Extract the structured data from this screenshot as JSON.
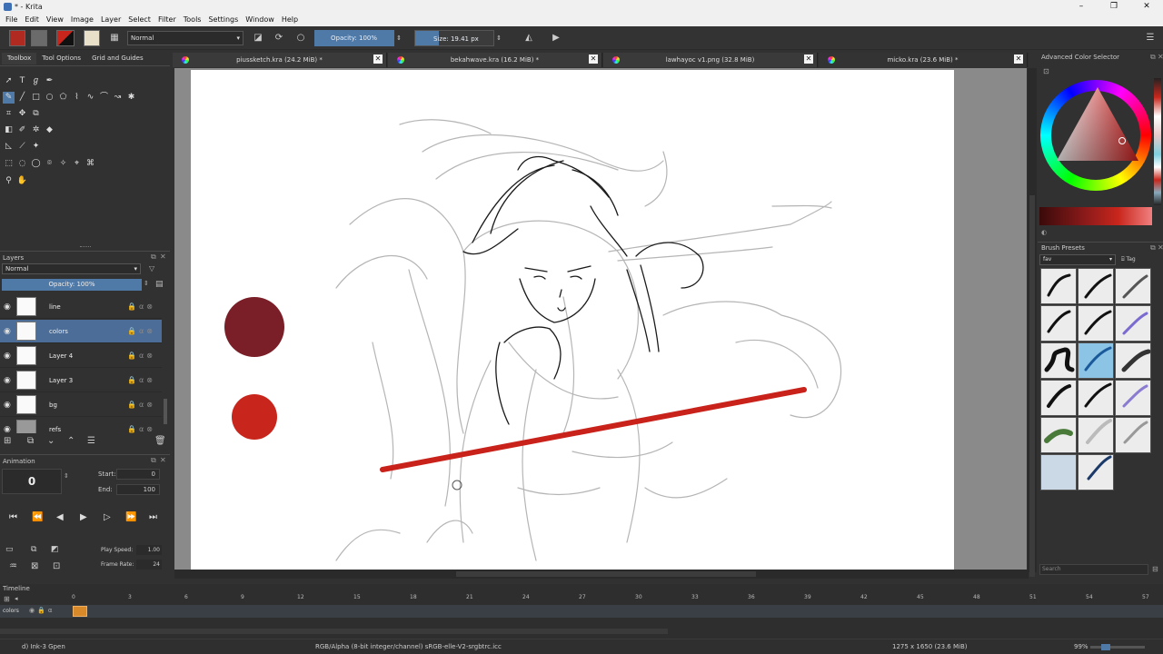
{
  "window": {
    "title": "* - Krita",
    "minimize": "–",
    "maximize": "❐",
    "close": "✕"
  },
  "menu": [
    "File",
    "Edit",
    "View",
    "Image",
    "Layer",
    "Select",
    "Filter",
    "Tools",
    "Settings",
    "Window",
    "Help"
  ],
  "toolbar": {
    "blend_mode": "Normal",
    "opacity_label": "Opacity: 100%",
    "size_label": "Size: 19.41 px"
  },
  "left_tabs": [
    "Toolbox",
    "Tool Options",
    "Grid and Guides"
  ],
  "layers_panel": {
    "title": "Layers",
    "blend_mode": "Normal",
    "opacity": "Opacity: 100%",
    "layers": [
      {
        "name": "line",
        "selected": false
      },
      {
        "name": "colors",
        "selected": true
      },
      {
        "name": "Layer 4",
        "selected": false
      },
      {
        "name": "Layer 3",
        "selected": false
      },
      {
        "name": "bg",
        "selected": false
      },
      {
        "name": "refs",
        "selected": false
      }
    ]
  },
  "animation_panel": {
    "title": "Animation",
    "frame": "0",
    "start_label": "Start:",
    "start_value": "0",
    "end_label": "End:",
    "end_value": "100",
    "play_speed_label": "Play Speed:",
    "play_speed_value": "1.00",
    "frame_rate_label": "Frame Rate:",
    "frame_rate_value": "24"
  },
  "doc_tabs": [
    {
      "label": "piussketch.kra (24.2 MiB) *"
    },
    {
      "label": "bekahwave.kra (16.2 MiB) *"
    },
    {
      "label": "lawhayoc v1.png (32.8 MiB)"
    },
    {
      "label": "micko.kra (23.6 MiB) *"
    }
  ],
  "right_panel": {
    "color_selector_title": "Advanced Color Selector",
    "brush_presets_title": "Brush Presets",
    "preset_filter": "fav",
    "tag_label": "Tag",
    "search_placeholder": "Search"
  },
  "timeline": {
    "title": "Timeline",
    "layer": "colors",
    "ticks": [
      "0",
      "3",
      "6",
      "9",
      "12",
      "15",
      "18",
      "21",
      "24",
      "27",
      "30",
      "33",
      "36",
      "39",
      "42",
      "45",
      "48",
      "51",
      "54",
      "57"
    ]
  },
  "status": {
    "brush": "d) Ink-3 Gpen",
    "color_space": "RGB/Alpha (8-bit integer/channel)  sRGB-elle-V2-srgbtrc.icc",
    "dimensions": "1275 x 1650 (23.6 MiB)",
    "zoom": "99%"
  },
  "colors": {
    "swatch_dark_red": "#7a1e27",
    "swatch_red": "#c8261c",
    "stroke_red": "#c8221b",
    "accent_blue": "#4f7aa8"
  }
}
